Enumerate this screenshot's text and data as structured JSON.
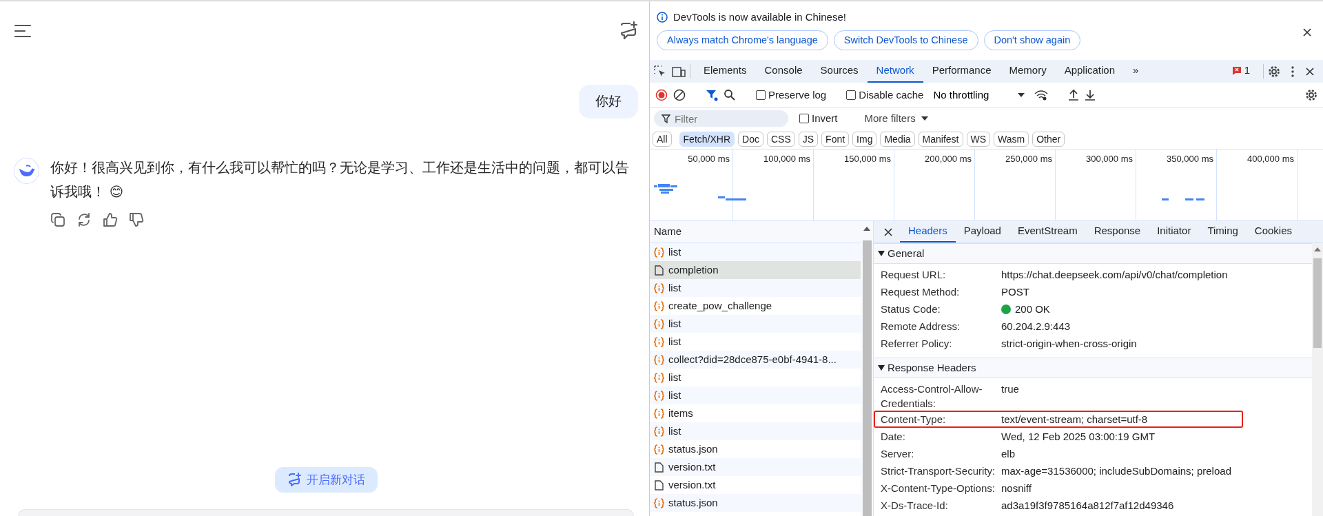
{
  "chat": {
    "user_message": "你好",
    "assistant_message": "你好！很高兴见到你，有什么我可以帮忙的吗？无论是学习、工作还是生活中的问题，都可以告诉我哦！ 😊",
    "new_chat_button": "开启新对话"
  },
  "devtools": {
    "infobar": {
      "message": "DevTools is now available in Chinese!",
      "buttons": [
        "Always match Chrome's language",
        "Switch DevTools to Chinese",
        "Don't show again"
      ]
    },
    "tabs": [
      {
        "label": "Elements",
        "selected": false
      },
      {
        "label": "Console",
        "selected": false
      },
      {
        "label": "Sources",
        "selected": false
      },
      {
        "label": "Network",
        "selected": true
      },
      {
        "label": "Performance",
        "selected": false
      },
      {
        "label": "Memory",
        "selected": false
      },
      {
        "label": "Application",
        "selected": false
      }
    ],
    "more_tabs": "»",
    "issues_count": "1",
    "toolbar": {
      "preserve_log": {
        "label": "Preserve log",
        "checked": false
      },
      "disable_cache": {
        "label": "Disable cache",
        "checked": false
      },
      "throttling": "No throttling"
    },
    "filter": {
      "placeholder": "Filter",
      "invert": {
        "label": "Invert",
        "checked": false
      },
      "more_filters": "More filters"
    },
    "type_filters": [
      {
        "label": "All",
        "selected": false
      },
      {
        "label": "Fetch/XHR",
        "selected": true
      },
      {
        "label": "Doc",
        "selected": false
      },
      {
        "label": "CSS",
        "selected": false
      },
      {
        "label": "JS",
        "selected": false
      },
      {
        "label": "Font",
        "selected": false
      },
      {
        "label": "Img",
        "selected": false
      },
      {
        "label": "Media",
        "selected": false
      },
      {
        "label": "Manifest",
        "selected": false
      },
      {
        "label": "WS",
        "selected": false
      },
      {
        "label": "Wasm",
        "selected": false
      },
      {
        "label": "Other",
        "selected": false
      }
    ],
    "timeline_ticks": [
      "50,000 ms",
      "100,000 ms",
      "150,000 ms",
      "200,000 ms",
      "250,000 ms",
      "300,000 ms",
      "350,000 ms",
      "400,000 ms"
    ],
    "requests": {
      "column": "Name",
      "rows": [
        {
          "name": "list",
          "kind": "fetch",
          "selected": false
        },
        {
          "name": "completion",
          "kind": "doc",
          "selected": true
        },
        {
          "name": "list",
          "kind": "fetch",
          "selected": false
        },
        {
          "name": "create_pow_challenge",
          "kind": "fetch",
          "selected": false
        },
        {
          "name": "list",
          "kind": "fetch",
          "selected": false
        },
        {
          "name": "list",
          "kind": "fetch",
          "selected": false
        },
        {
          "name": "collect?did=28dce875-e0bf-4941-8...",
          "kind": "fetch",
          "selected": false
        },
        {
          "name": "list",
          "kind": "fetch",
          "selected": false
        },
        {
          "name": "list",
          "kind": "fetch",
          "selected": false
        },
        {
          "name": "items",
          "kind": "fetch",
          "selected": false
        },
        {
          "name": "list",
          "kind": "fetch",
          "selected": false
        },
        {
          "name": "status.json",
          "kind": "fetch",
          "selected": false
        },
        {
          "name": "version.txt",
          "kind": "doc",
          "selected": false
        },
        {
          "name": "version.txt",
          "kind": "doc",
          "selected": false
        },
        {
          "name": "status.json",
          "kind": "fetch",
          "selected": false
        }
      ]
    },
    "detail_tabs": [
      {
        "label": "Headers",
        "selected": true
      },
      {
        "label": "Payload",
        "selected": false
      },
      {
        "label": "EventStream",
        "selected": false
      },
      {
        "label": "Response",
        "selected": false
      },
      {
        "label": "Initiator",
        "selected": false
      },
      {
        "label": "Timing",
        "selected": false
      },
      {
        "label": "Cookies",
        "selected": false
      }
    ],
    "sections": [
      {
        "title": "General",
        "expanded": true,
        "rows": [
          {
            "key": "Request URL:",
            "value": "https://chat.deepseek.com/api/v0/chat/completion",
            "highlighted": false
          },
          {
            "key": "Request Method:",
            "value": "POST",
            "highlighted": false
          },
          {
            "key": "Status Code:",
            "value": "200 OK",
            "color": "#1ea446",
            "highlighted": false
          },
          {
            "key": "Remote Address:",
            "value": "60.204.2.9:443",
            "highlighted": false
          },
          {
            "key": "Referrer Policy:",
            "value": "strict-origin-when-cross-origin",
            "highlighted": false
          }
        ]
      },
      {
        "title": "Response Headers",
        "expanded": true,
        "rows": [
          {
            "key": "Access-Control-Allow-Credentials:",
            "value": "true",
            "highlighted": false
          },
          {
            "key": "Content-Type:",
            "value": "text/event-stream; charset=utf-8",
            "highlighted": true
          },
          {
            "key": "Date:",
            "value": "Wed, 12 Feb 2025 03:00:19 GMT",
            "highlighted": false
          },
          {
            "key": "Server:",
            "value": "elb",
            "highlighted": false
          },
          {
            "key": "Strict-Transport-Security:",
            "value": "max-age=31536000; includeSubDomains; preload",
            "highlighted": false
          },
          {
            "key": "X-Content-Type-Options:",
            "value": "nosniff",
            "highlighted": false
          },
          {
            "key": "X-Ds-Trace-Id:",
            "value": "ad3a19f3f9785164a812f7af12d49346",
            "highlighted": false
          }
        ]
      }
    ]
  }
}
